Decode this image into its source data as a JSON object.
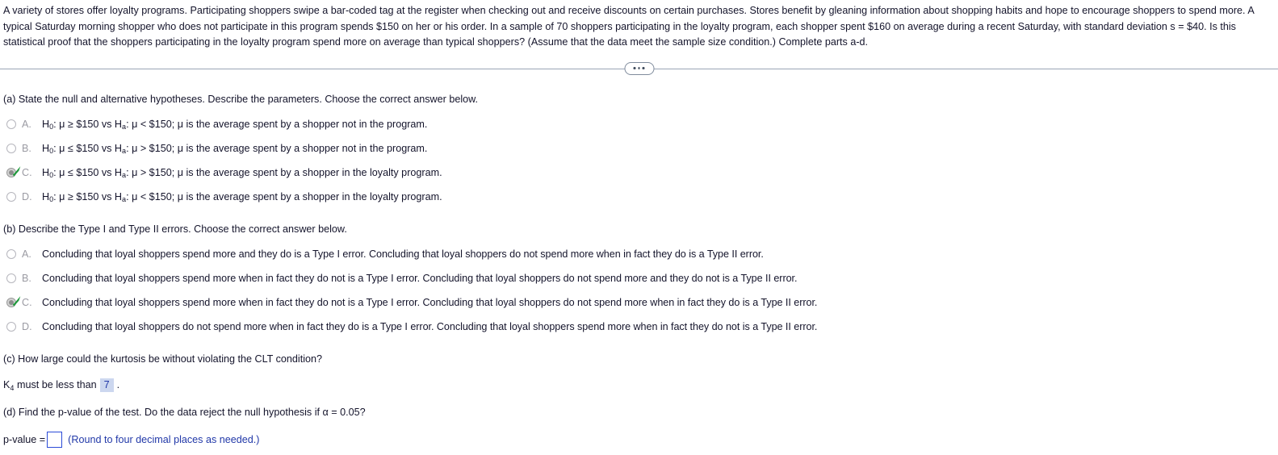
{
  "problem": {
    "lines": [
      "A variety of stores offer loyalty programs. Participating shoppers swipe a bar-coded tag at the register when checking out and receive discounts on certain purchases. Stores benefit by gleaning information about shopping habits and hope to encourage shoppers to spend more. A",
      "typical Saturday morning shopper who does not participate in this program spends $150 on her or his order. In a sample of 70 shoppers participating in the loyalty program, each shopper spent $160 on average during a recent Saturday, with standard deviation s = $40. Is this",
      "statistical proof that the shoppers participating in the loyalty program spend more on average than typical shoppers? (Assume that the data meet the sample size condition.) Complete parts a-d."
    ]
  },
  "divider": {
    "ellipsis_label": "..."
  },
  "parts": {
    "a": {
      "prompt": "(a) State the null and alternative hypotheses. Describe the parameters. Choose the correct answer below.",
      "selected": "C",
      "options": [
        {
          "letter": "A.",
          "h0_label": "H",
          "h0_sub": "0",
          "h0_rest": ":  μ ≥ $150 vs H",
          "ha_sub": "a",
          "ha_rest": ":  μ < $150;  μ is the average spent by a shopper not in the program.",
          "selected": false
        },
        {
          "letter": "B.",
          "h0_label": "H",
          "h0_sub": "0",
          "h0_rest": ":  μ ≤ $150 vs H",
          "ha_sub": "a",
          "ha_rest": ":  μ > $150;  μ is the average spent by a shopper not in the program.",
          "selected": false
        },
        {
          "letter": "C.",
          "h0_label": "H",
          "h0_sub": "0",
          "h0_rest": ":  μ ≤ $150 vs H",
          "ha_sub": "a",
          "ha_rest": ":  μ > $150;  μ is the average spent by a shopper in the loyalty program.",
          "selected": true
        },
        {
          "letter": "D.",
          "h0_label": "H",
          "h0_sub": "0",
          "h0_rest": ":  μ ≥ $150 vs H",
          "ha_sub": "a",
          "ha_rest": ":  μ < $150;  μ is the average spent by a shopper in the loyalty program.",
          "selected": false
        }
      ]
    },
    "b": {
      "prompt": "(b) Describe the Type I and Type II errors. Choose the correct answer below.",
      "selected": "C",
      "options": [
        {
          "letter": "A.",
          "text": "Concluding that loyal shoppers spend more and they do is a Type I error. Concluding that loyal shoppers do not spend more when in fact they do is a Type II error.",
          "selected": false
        },
        {
          "letter": "B.",
          "text": "Concluding that loyal shoppers spend more when in fact they do not is a Type I error. Concluding that loyal shoppers do not spend more and they do not is a Type II error.",
          "selected": false
        },
        {
          "letter": "C.",
          "text": "Concluding that loyal shoppers spend more when in fact they do not is a Type I error. Concluding that loyal shoppers do not spend more when in fact they do is a Type II error.",
          "selected": true
        },
        {
          "letter": "D.",
          "text": "Concluding that loyal shoppers do not spend more when in fact they do is a Type I error. Concluding that loyal shoppers spend more when in fact they do not is a Type II error.",
          "selected": false
        }
      ]
    },
    "c": {
      "prompt": "(c) How large could the kurtosis be without violating the CLT condition?",
      "answer_prefix_label": "K",
      "answer_prefix_sub": "4",
      "answer_prefix_rest": " must be less than",
      "answer_value": "7",
      "answer_suffix": "."
    },
    "d": {
      "prompt": "(d) Find the p-value of the test. Do the data reject the null hypothesis if α = 0.05?",
      "answer_label": "p-value =",
      "answer_value": "",
      "hint": "(Round to four decimal places as needed.)"
    }
  },
  "colors": {
    "text": "#14142b",
    "option_letter": "#9b9ba3",
    "link_blue": "#2138a8",
    "input_border": "#2b4bd8",
    "filled_answer_bg": "#ccd7ef",
    "check_green": "#1f9a3c",
    "divider": "#9aa5b5"
  }
}
